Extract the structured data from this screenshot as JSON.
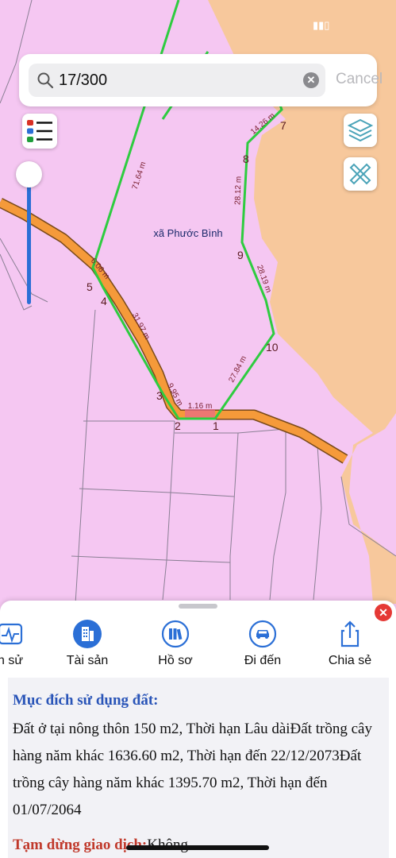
{
  "search": {
    "value": "17/300",
    "cancel_label": "Cancel",
    "clear_symbol": "✕"
  },
  "map": {
    "commune_label": "xã Phước Bình",
    "edge_labels": [
      "71.64 m",
      "14.26 m",
      "28.12 m",
      "28.19 m",
      "27.84 m",
      "1.16 m",
      "9.95 m",
      "31.97 m",
      "6.06 m"
    ],
    "vertex_labels": [
      "1",
      "2",
      "3",
      "4",
      "5",
      "7",
      "8",
      "9",
      "10"
    ],
    "colors": {
      "residential": "#f5c7f2",
      "agricultural": "#f7c89c",
      "road": "#f59a3a",
      "boundary": "#2ecc40"
    }
  },
  "actions": [
    {
      "label": "n sử",
      "icon": "activity-icon"
    },
    {
      "label": "Tài sản",
      "icon": "building-icon"
    },
    {
      "label": "Hồ sơ",
      "icon": "books-icon"
    },
    {
      "label": "Đi đến",
      "icon": "car-icon"
    },
    {
      "label": "Chia sẻ",
      "icon": "share-icon"
    }
  ],
  "info": {
    "purpose_heading": "Mục đích sử dụng đất:",
    "purpose_text": "Đất ở tại nông thôn 150 m2, Thời hạn Lâu dàiĐất trồng cây hàng năm khác 1636.60 m2, Thời hạn đến 22/12/2073Đất trồng cây hàng năm khác 1395.70 m2, Thời hạn đến 01/07/2064",
    "suspend_label": "Tạm dừng giao dịch:",
    "suspend_value": "Không"
  }
}
